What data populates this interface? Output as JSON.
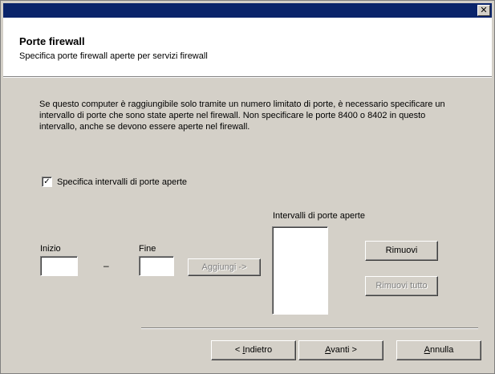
{
  "window": {
    "close_glyph": "✕"
  },
  "header": {
    "title": "Porte firewall",
    "subtitle": "Specifica porte firewall aperte per servizi firewall"
  },
  "description": "Se questo computer è raggiungibile solo tramite un numero limitato di porte, è necessario specificare un intervallo di porte che sono state aperte nel firewall. Non specificare le porte 8400 o 8402 in questo intervallo, anche se devono essere aperte nel firewall.",
  "checkbox": {
    "label": "Specifica intervalli di porte aperte",
    "checked": true,
    "check_glyph": "✓"
  },
  "range": {
    "start_label": "Inizio",
    "end_label": "Fine",
    "dash": "–",
    "start_value": "",
    "end_value": ""
  },
  "list": {
    "label": "Intervalli di porte aperte",
    "items": []
  },
  "buttons": {
    "add": "Aggiungi ->",
    "remove": "Rimuovi",
    "remove_all": "Rimuovi tutto",
    "back_prefix": "< ",
    "back_key": "I",
    "back_rest": "ndietro",
    "next_key": "A",
    "next_rest": "vanti >",
    "cancel_key": "A",
    "cancel_rest": "nnulla"
  },
  "colors": {
    "titlebar": "#0a246a",
    "dialog_bg": "#d4d0c8",
    "header_bg": "#ffffff"
  }
}
